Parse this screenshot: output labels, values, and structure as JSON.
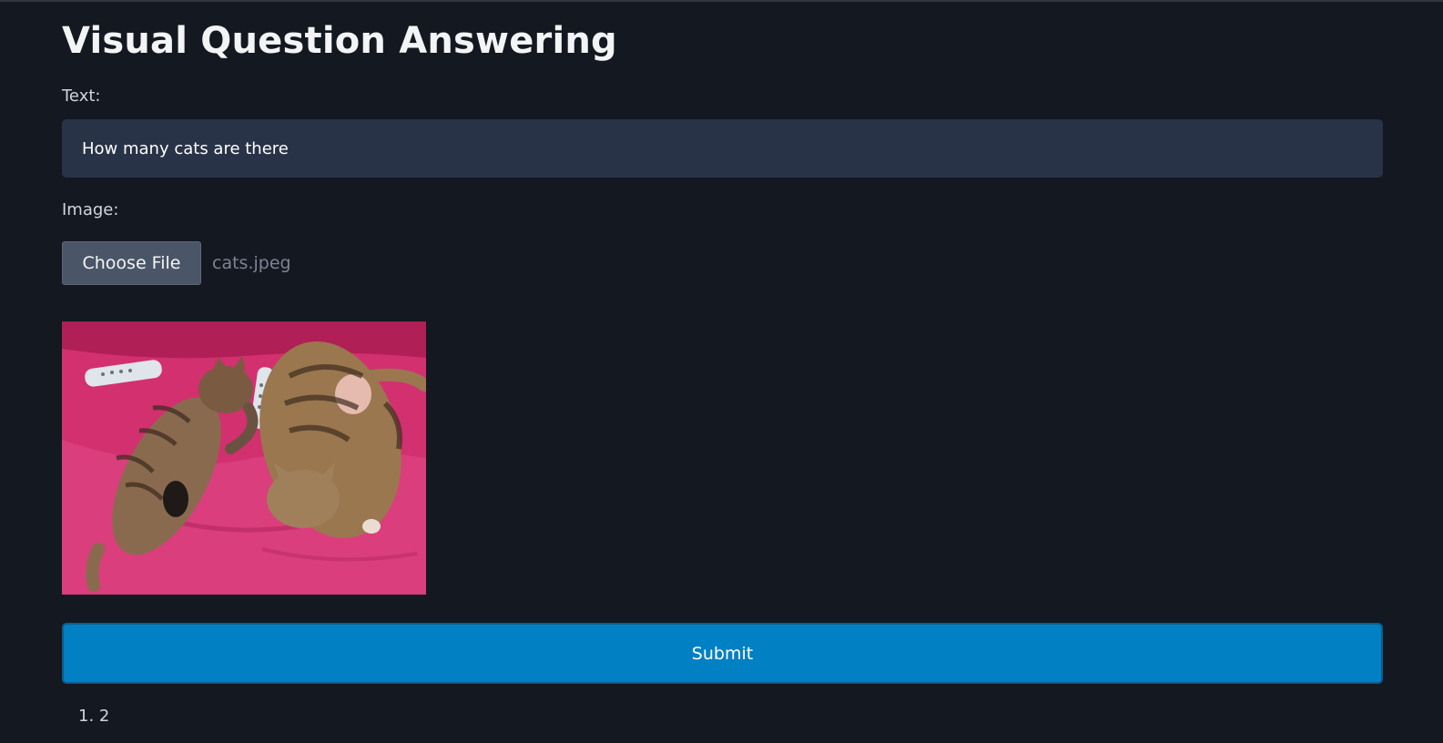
{
  "page": {
    "title": "Visual Question Answering"
  },
  "form": {
    "text_label": "Text:",
    "text_value": "How many cats are there",
    "image_label": "Image:",
    "choose_file_label": "Choose File",
    "file_name": "cats.jpeg",
    "submit_label": "Submit"
  },
  "preview": {
    "image_name": "cats-on-pink-couch-image",
    "colors": {
      "couch": "#d2306f",
      "cat": "#8a6a4f"
    }
  },
  "results": {
    "items": [
      "1. 2"
    ]
  }
}
